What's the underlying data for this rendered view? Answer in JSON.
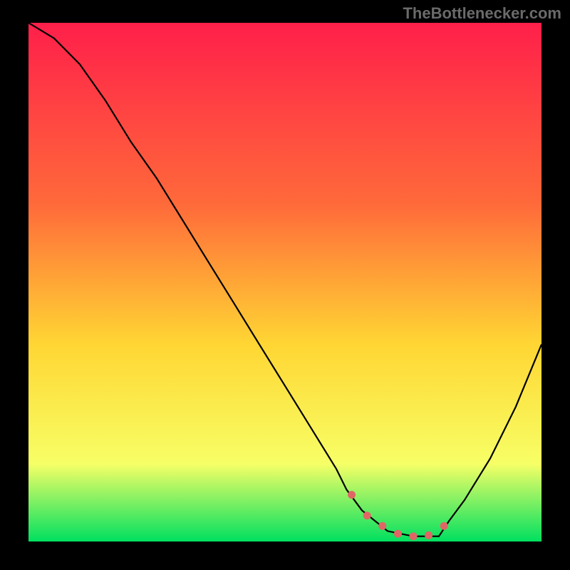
{
  "watermark": "TheBottlenecker.com",
  "colors": {
    "gradient_top": "#ff1f4a",
    "gradient_mid1": "#ff6a3a",
    "gradient_mid2": "#ffd633",
    "gradient_mid3": "#f7ff66",
    "gradient_bottom": "#00e060",
    "curve": "#000000",
    "marker": "#e06666",
    "background": "#000000"
  },
  "chart_data": {
    "type": "line",
    "title": "",
    "xlabel": "",
    "ylabel": "",
    "xlim": [
      0,
      100
    ],
    "ylim": [
      0,
      100
    ],
    "series": [
      {
        "name": "curve",
        "x": [
          0,
          5,
          10,
          15,
          20,
          25,
          30,
          35,
          40,
          45,
          50,
          55,
          60,
          62,
          65,
          70,
          75,
          80,
          82,
          85,
          90,
          95,
          100
        ],
        "values": [
          100,
          97,
          92,
          85,
          77,
          70,
          62,
          54,
          46,
          38,
          30,
          22,
          14,
          10,
          6,
          2,
          1,
          1,
          4,
          8,
          16,
          26,
          38
        ]
      }
    ],
    "markers": {
      "name": "highlight-dots",
      "x": [
        63,
        66,
        69,
        72,
        75,
        78,
        81
      ],
      "values": [
        9,
        5,
        3,
        1.5,
        1,
        1.2,
        3
      ]
    }
  }
}
